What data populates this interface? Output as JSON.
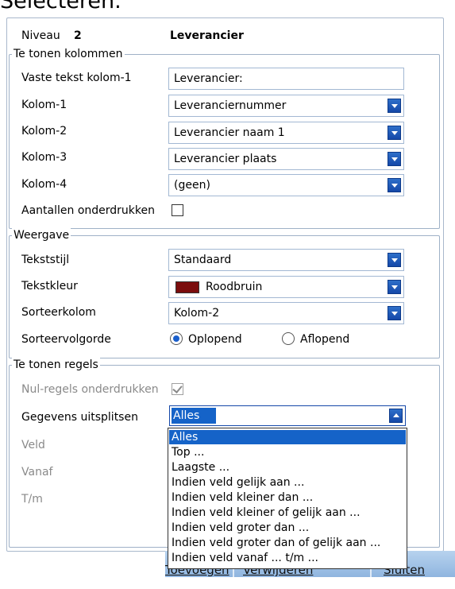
{
  "page_heading_fragment": "Selecteren.",
  "header": {
    "niveau_label": "Niveau",
    "niveau_value": "2",
    "niveau_name": "Leverancier"
  },
  "columns_group": {
    "title": "Te tonen kolommen",
    "fixed_text_label": "Vaste tekst kolom-1",
    "fixed_text_value": "Leverancier:",
    "col1_label": "Kolom-1",
    "col1_value": "Leveranciernummer",
    "col2_label": "Kolom-2",
    "col2_value": "Leverancier naam 1",
    "col3_label": "Kolom-3",
    "col3_value": "Leverancier plaats",
    "col4_label": "Kolom-4",
    "col4_value": "(geen)",
    "suppress_counts_label": "Aantallen onderdrukken",
    "suppress_counts_checked": false
  },
  "display_group": {
    "title": "Weergave",
    "text_style_label": "Tekststijl",
    "text_style_value": "Standaard",
    "text_color_label": "Tekstkleur",
    "text_color_value": "Roodbruin",
    "text_color_hex": "#7b0d0d",
    "sort_column_label": "Sorteerkolom",
    "sort_column_value": "Kolom-2",
    "sort_order_label": "Sorteervolgorde",
    "sort_asc_label": "Oplopend",
    "sort_desc_label": "Aflopend",
    "sort_order_selected": "Oplopend"
  },
  "rows_group": {
    "title": "Te tonen regels",
    "null_rows_label": "Nul-regels onderdrukken",
    "null_rows_checked": true,
    "split_label": "Gegevens uitsplitsen",
    "split_value": "Alles",
    "veld_label": "Veld",
    "vanaf_label": "Vanaf",
    "tm_label": "T/m",
    "split_options": [
      "Alles",
      "Top ...",
      "Laagste ...",
      "Indien veld gelijk aan ...",
      "Indien veld kleiner dan ...",
      "Indien veld kleiner of gelijk aan ...",
      "Indien veld groter dan ...",
      "Indien veld groter dan of gelijk aan ...",
      "Indien veld vanaf ... t/m ..."
    ]
  },
  "bottom_bar": {
    "add_label": "Toevoegen",
    "delete_label": "Verwijderen",
    "close_label": "Sluiten"
  },
  "colors": {
    "accent": "#1563c8",
    "bar_bg": "#a9c8ea",
    "group_border": "#9fb1c7"
  }
}
